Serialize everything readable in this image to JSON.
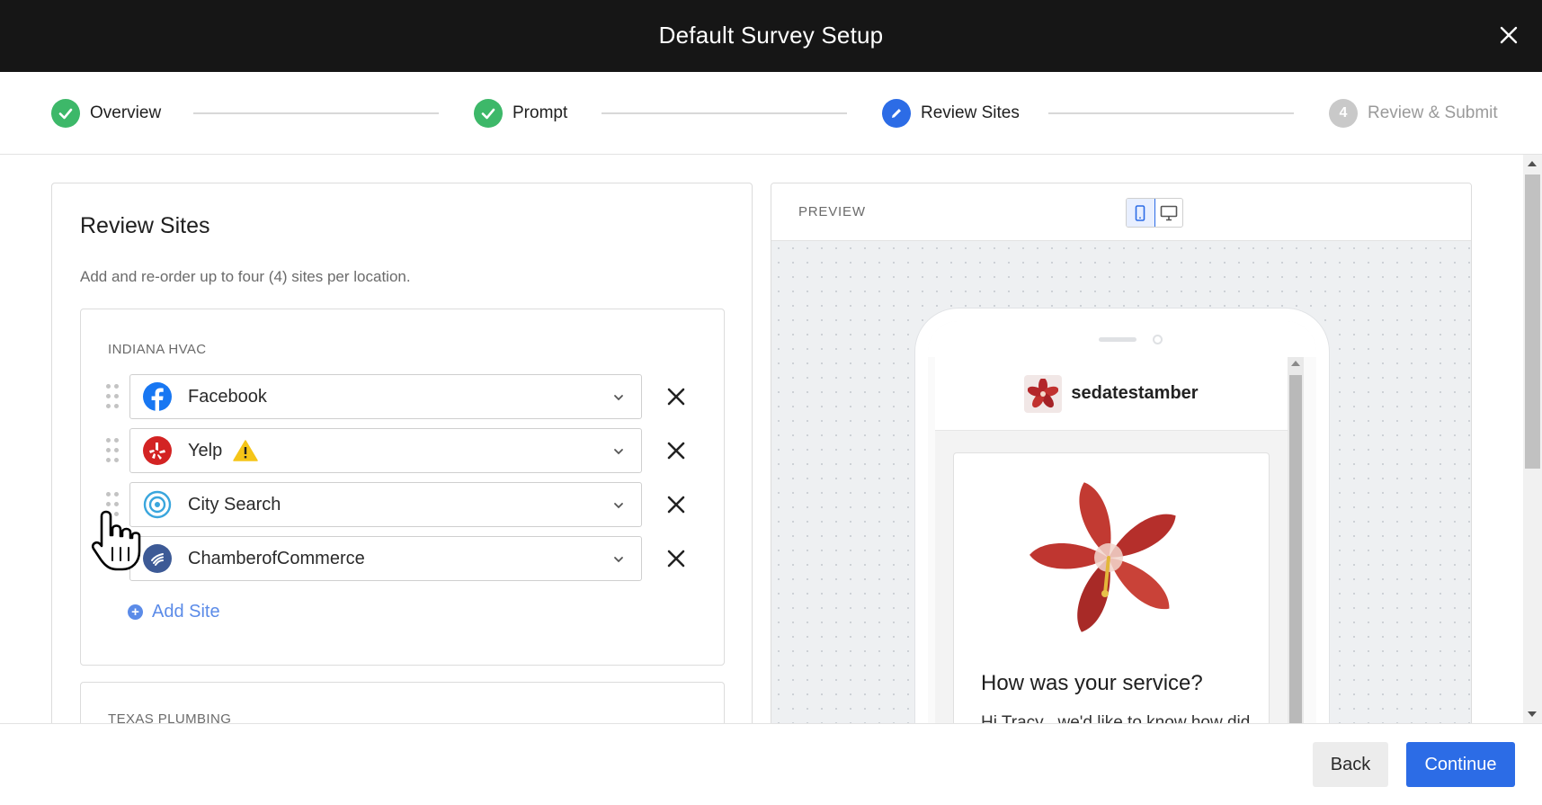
{
  "header": {
    "title": "Default Survey Setup"
  },
  "steps": [
    {
      "label": "Overview",
      "state": "done"
    },
    {
      "label": "Prompt",
      "state": "done"
    },
    {
      "label": "Review Sites",
      "state": "active"
    },
    {
      "label": "Review & Submit",
      "state": "todo",
      "number": "4"
    }
  ],
  "review_sites": {
    "title": "Review Sites",
    "description": "Add and re-order up to four (4) sites per location.",
    "locations": [
      {
        "name": "INDIANA HVAC",
        "sites": [
          {
            "name": "Facebook",
            "icon": "facebook-icon",
            "warning": false
          },
          {
            "name": "Yelp",
            "icon": "yelp-icon",
            "warning": true
          },
          {
            "name": "City Search",
            "icon": "citysearch-icon",
            "warning": false
          },
          {
            "name": "ChamberofCommerce",
            "icon": "chamberofcommerce-icon",
            "warning": false
          }
        ],
        "add_label": "Add Site"
      },
      {
        "name": "TEXAS PLUMBING"
      }
    ]
  },
  "preview": {
    "label": "PREVIEW",
    "mode": "mobile",
    "brand_name": "sedatestamber",
    "question": "How was your service?",
    "message": "Hi Tracy , we'd like to know how did Charles Brown do in"
  },
  "footer": {
    "back_label": "Back",
    "continue_label": "Continue"
  },
  "colors": {
    "accent": "#2c6ce6",
    "success": "#3db869",
    "header_bg": "#161616",
    "warning": "#f5c518"
  }
}
